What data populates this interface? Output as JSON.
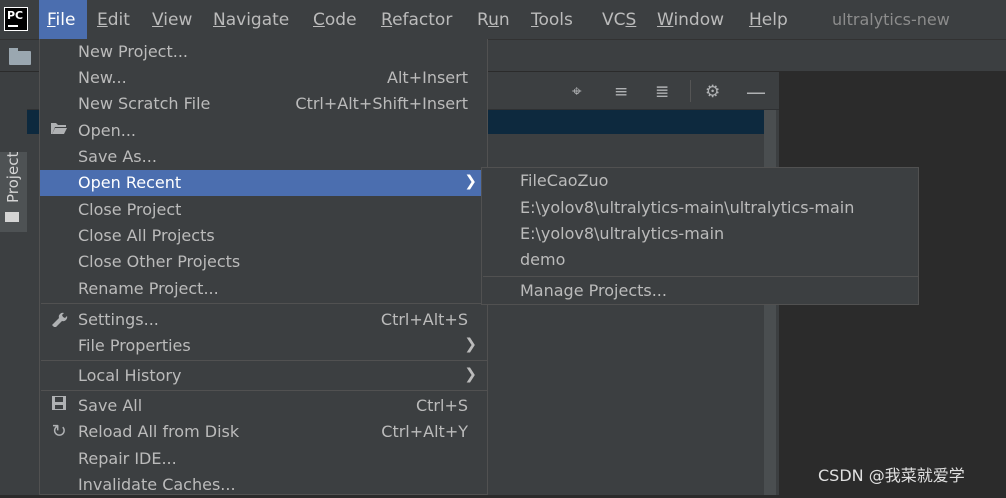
{
  "menubar": {
    "logo": "PC",
    "items": [
      {
        "label": "File",
        "mnemonic": "F",
        "rest": "ile"
      },
      {
        "label": "Edit",
        "mnemonic": "E",
        "rest": "dit"
      },
      {
        "label": "View",
        "mnemonic": "V",
        "rest": "iew"
      },
      {
        "label": "Navigate",
        "mnemonic": "N",
        "rest": "avigate"
      },
      {
        "label": "Code",
        "mnemonic": "C",
        "rest": "ode"
      },
      {
        "label": "Refactor",
        "mnemonic": "R",
        "rest": "efactor"
      },
      {
        "label": "Run",
        "pre": "R",
        "mnemonic": "u",
        "rest": "n"
      },
      {
        "label": "Tools",
        "mnemonic": "T",
        "rest": "ools"
      },
      {
        "label": "VCS",
        "pre": "VC",
        "mnemonic": "S",
        "rest": ""
      },
      {
        "label": "Window",
        "mnemonic": "W",
        "rest": "indow"
      },
      {
        "label": "Help",
        "mnemonic": "H",
        "rest": "elp"
      }
    ],
    "project_title": "ultralytics-new"
  },
  "tool_strip": {
    "project_tab": "Project"
  },
  "file_menu": {
    "items": [
      {
        "label": "New Project...",
        "shortcut": ""
      },
      {
        "label": "New...",
        "shortcut": "Alt+Insert"
      },
      {
        "label": "New Scratch File",
        "shortcut": "Ctrl+Alt+Shift+Insert"
      },
      {
        "label": "Open...",
        "shortcut": ""
      },
      {
        "label": "Save As...",
        "shortcut": ""
      },
      {
        "label": "Open Recent",
        "shortcut": ""
      },
      {
        "label": "Close Project",
        "shortcut": ""
      },
      {
        "label": "Close All Projects",
        "shortcut": ""
      },
      {
        "label": "Close Other Projects",
        "shortcut": ""
      },
      {
        "label": "Rename Project...",
        "shortcut": ""
      },
      {
        "label": "Settings...",
        "shortcut": "Ctrl+Alt+S"
      },
      {
        "label": "File Properties",
        "shortcut": ""
      },
      {
        "label": "Local History",
        "shortcut": ""
      },
      {
        "label": "Save All",
        "shortcut": "Ctrl+S"
      },
      {
        "label": "Reload All from Disk",
        "shortcut": "Ctrl+Alt+Y"
      },
      {
        "label": "Repair IDE...",
        "shortcut": ""
      },
      {
        "label": "Invalidate Caches...",
        "shortcut": ""
      }
    ]
  },
  "open_recent_submenu": {
    "items": [
      "FileCaoZuo",
      "E:\\yolov8\\ultralytics-main\\ultralytics-main",
      "E:\\yolov8\\ultralytics-main",
      "demo",
      "Manage Projects..."
    ]
  },
  "watermark": "CSDN @我菜就爱学",
  "colors": {
    "selection": "#4b6eaf",
    "menu_bg": "#3c3f41",
    "editor_bg": "#2b2b2b"
  },
  "icons": [
    "folder-icon",
    "wrench-icon",
    "save-icon",
    "reload-icon",
    "locate-icon",
    "expand-all-icon",
    "collapse-all-icon",
    "gear-icon",
    "minimize-icon"
  ]
}
